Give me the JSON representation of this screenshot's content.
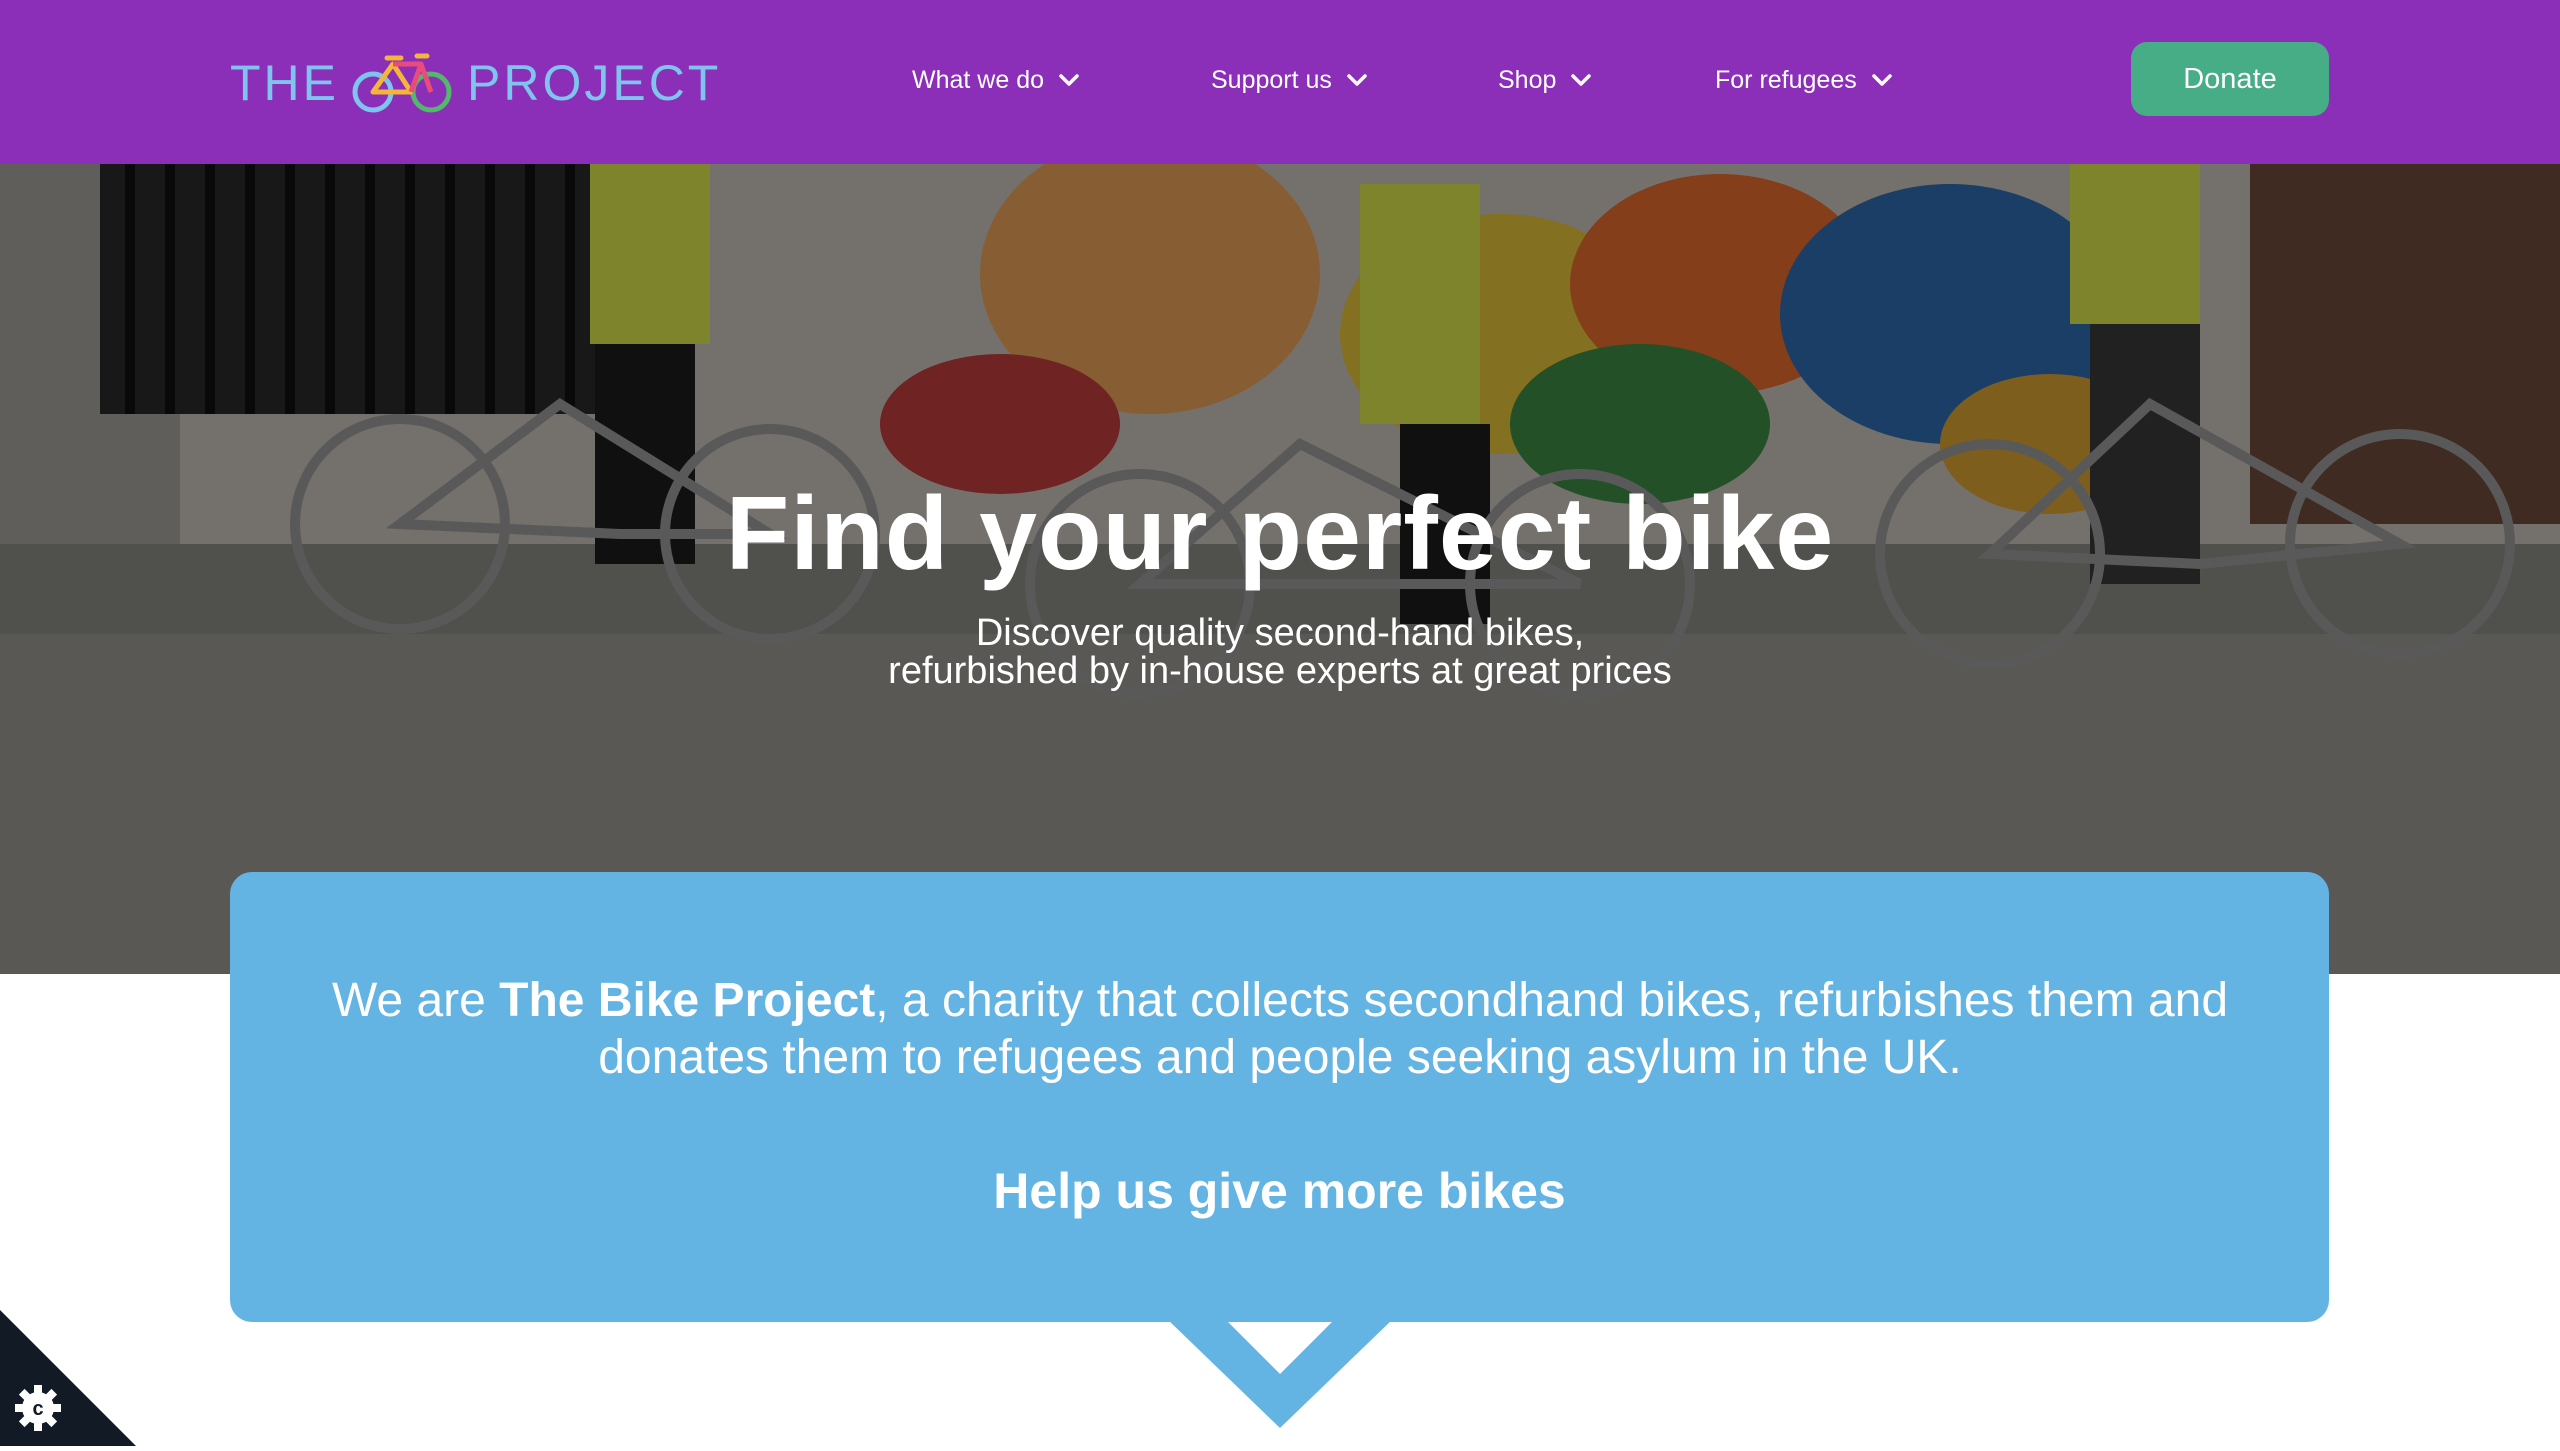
{
  "header": {
    "logo": {
      "left_text": "THE",
      "right_text": "PROJECT"
    },
    "nav": [
      {
        "label": "What we do"
      },
      {
        "label": "Support us"
      },
      {
        "label": "Shop"
      },
      {
        "label": "For refugees"
      }
    ],
    "donate_label": "Donate"
  },
  "hero": {
    "title": "Find your perfect bike",
    "subtitle_line1": "Discover quality second-hand bikes,",
    "subtitle_line2": "refurbished by in-house experts at great prices"
  },
  "info": {
    "prefix": "We are ",
    "org_name": "The Bike Project",
    "suffix": ", a charity that collects secondhand bikes, refurbishes them and donates them to refugees and people seeking asylum in the UK.",
    "cta": "Help us give more bikes"
  },
  "icons": {
    "logo_bike": "bicycle-icon",
    "nav_chevron": "chevron-down-icon",
    "cookie": "cookie-settings-icon"
  },
  "colors": {
    "header_bg": "#8b2fb9",
    "logo_text": "#7ec4ec",
    "donate_bg": "#46ad86",
    "card_bg": "#63b3e3",
    "cookie_bg": "#121a26"
  }
}
